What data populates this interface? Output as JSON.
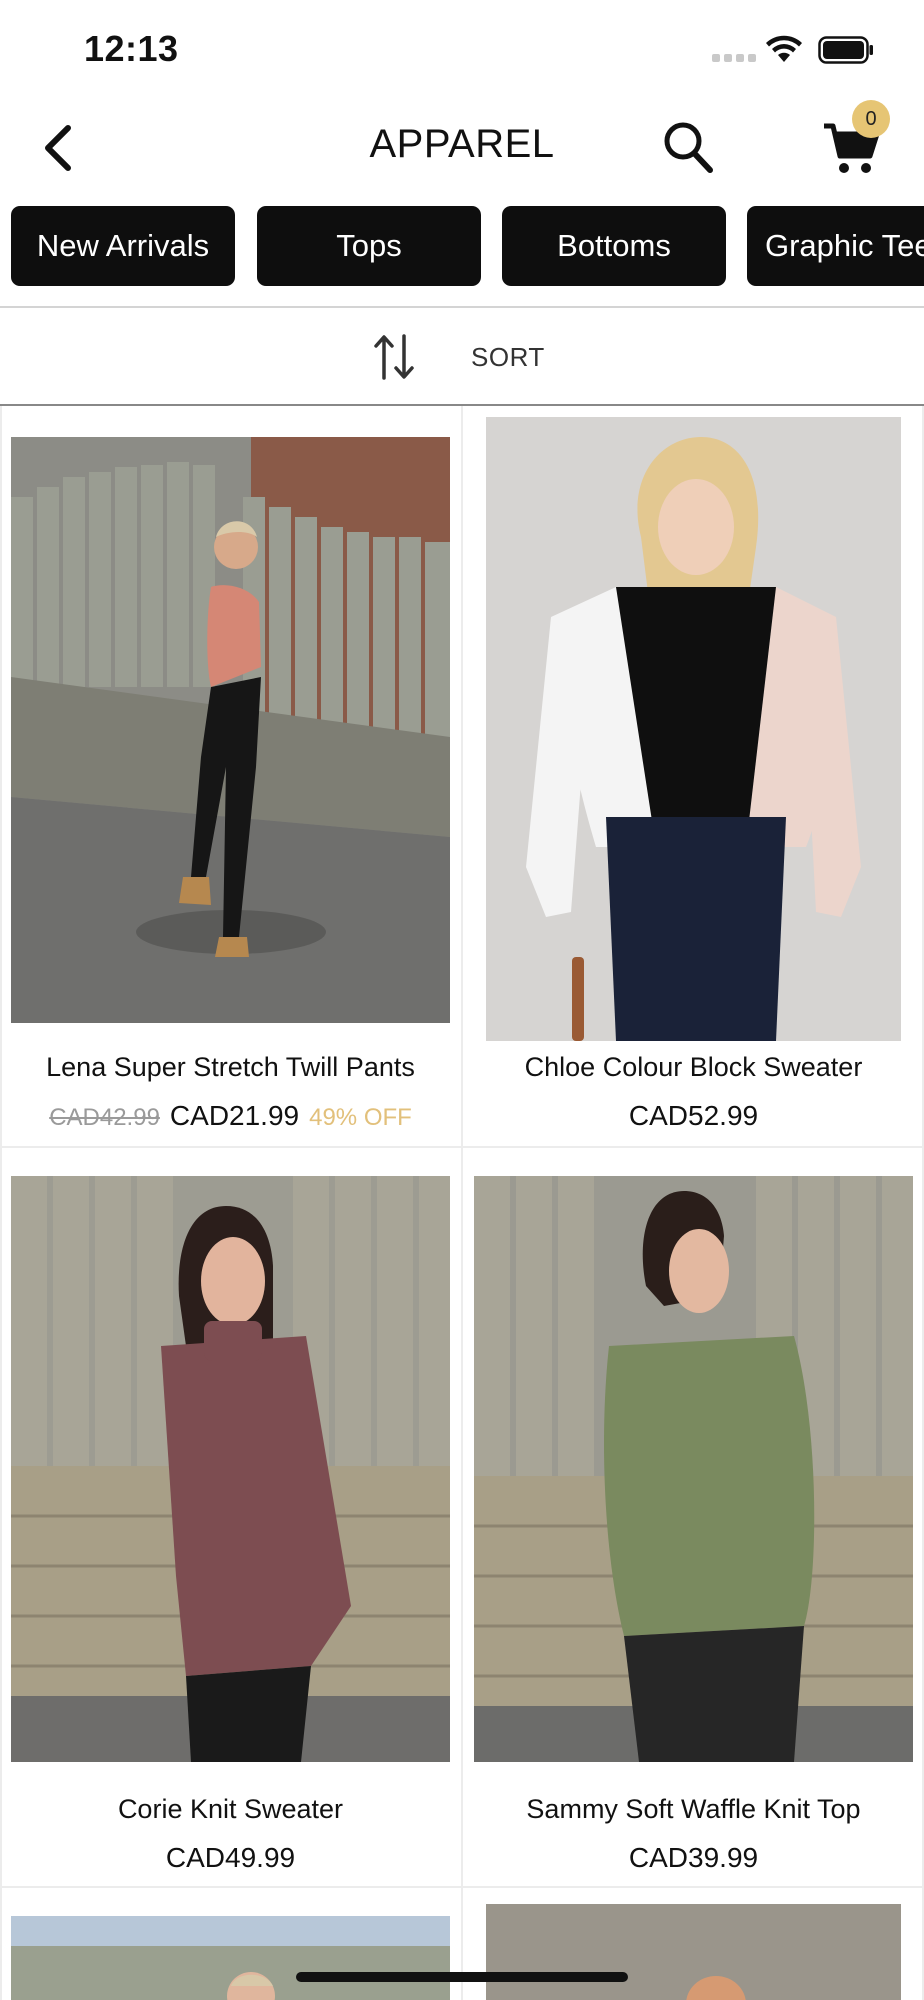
{
  "status_bar": {
    "time": "12:13"
  },
  "nav": {
    "title": "APPAREL",
    "cart_count": "0"
  },
  "categories": [
    "New Arrivals",
    "Tops",
    "Bottoms",
    "Graphic Tees"
  ],
  "sort": {
    "label": "SORT"
  },
  "products": [
    {
      "name": "Lena Super Stretch Twill Pants",
      "old_price": "CAD42.99",
      "price": "CAD21.99",
      "discount": "49% OFF"
    },
    {
      "name": "Chloe Colour Block Sweater",
      "price": "CAD52.99"
    },
    {
      "name": "Corie Knit Sweater",
      "price": "CAD49.99"
    },
    {
      "name": "Sammy Soft Waffle Knit Top",
      "price": "CAD39.99"
    }
  ],
  "colors": {
    "accent": "#e2c07b",
    "badge": "#e6c574",
    "chip_bg": "#0e0e0e"
  }
}
